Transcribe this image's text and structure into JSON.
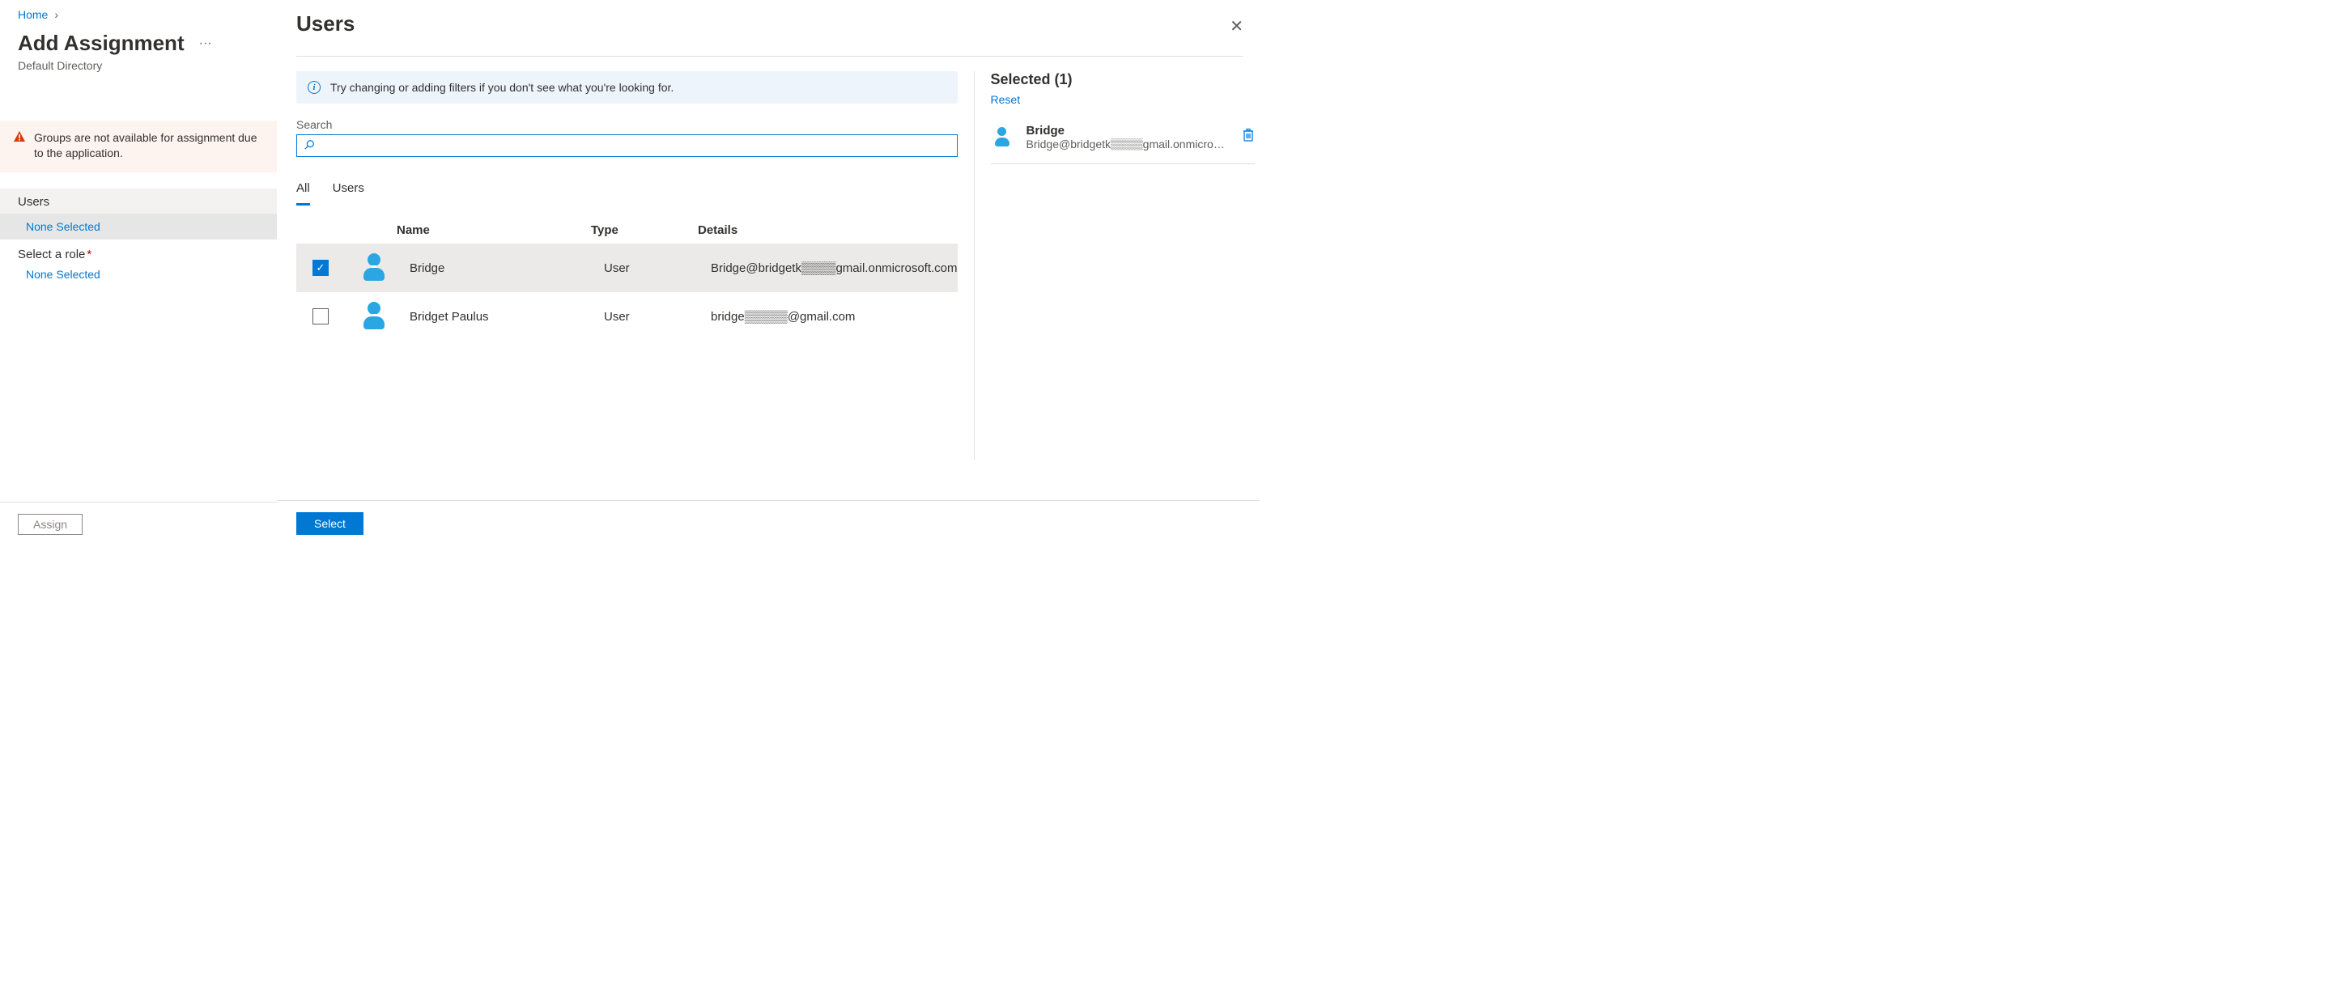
{
  "breadcrumb": {
    "home": "Home"
  },
  "page": {
    "title": "Add Assignment",
    "subtitle": "Default Directory",
    "ellipsis": "···"
  },
  "warning": "Groups are not available for assignment due to the application.",
  "left": {
    "users_label": "Users",
    "users_link": "None Selected",
    "role_label": "Select a role",
    "role_link": "None Selected"
  },
  "assign_btn": "Assign",
  "panel": {
    "title": "Users",
    "info": "Try changing or adding filters if you don't see what you're looking for.",
    "search_label": "Search",
    "tabs": {
      "all": "All",
      "users": "Users"
    },
    "columns": {
      "name": "Name",
      "type": "Type",
      "details": "Details"
    },
    "rows": [
      {
        "checked": true,
        "name": "Bridge",
        "type": "User",
        "details": "Bridge@bridgetk▒▒▒▒gmail.onmicrosoft.com"
      },
      {
        "checked": false,
        "name": "Bridget Paulus",
        "type": "User",
        "details": "bridge▒▒▒▒▒@gmail.com"
      }
    ],
    "selected_title": "Selected (1)",
    "reset": "Reset",
    "selected_item": {
      "name": "Bridge",
      "email": "Bridge@bridgetk▒▒▒▒gmail.onmicrosoft.c…"
    },
    "select_btn": "Select"
  }
}
